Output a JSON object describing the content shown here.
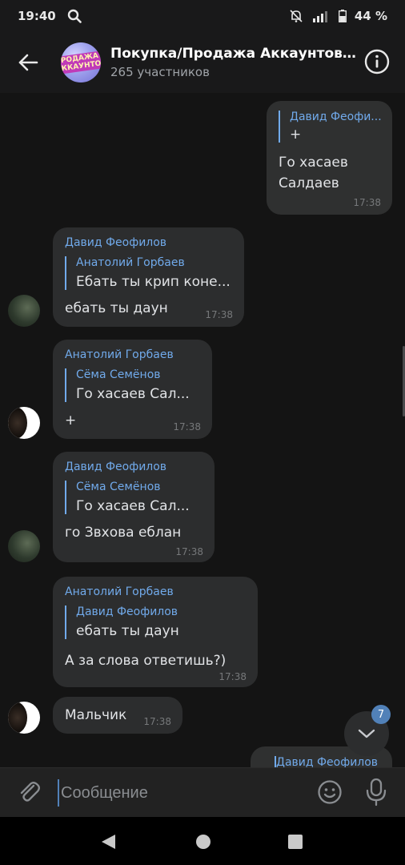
{
  "status_bar": {
    "time": "19:40",
    "battery": "44 %",
    "icons": [
      "search-icon",
      "mute-icon",
      "signal-icon",
      "battery-icon"
    ]
  },
  "header": {
    "title": "Покупка/Продажа Аккаунтов К.",
    "subtitle": "265 участников",
    "avatar_text": "ПРОДАЖА АККАУНТОВ"
  },
  "messages": [
    {
      "id": "m1",
      "direction": "out",
      "reply_name": "Давид Феофи...",
      "reply_text": "+",
      "body_lines": [
        "Го хасаев",
        "Салдаев"
      ],
      "time": "17:38"
    },
    {
      "id": "m2",
      "direction": "in",
      "sender": "Давид Феофилов",
      "reply_name": "Анатолий Горбаев",
      "reply_text": "Ебать ты крип коне...",
      "body": "ебать ты даун",
      "time": "17:38"
    },
    {
      "id": "m3",
      "direction": "in",
      "sender": "Анатолий Горбаев",
      "reply_name": "Сёма Семёнов",
      "reply_text": "Го хасаев  Сал...",
      "body": "+",
      "time": "17:38"
    },
    {
      "id": "m4",
      "direction": "in",
      "sender": "Давид Феофилов",
      "reply_name": "Сёма Семёнов",
      "reply_text": "Го хасаев  Сал...",
      "body": "го Звхова еблан",
      "time": "17:38"
    },
    {
      "id": "m5",
      "direction": "in",
      "sender": "Анатолий Горбаев",
      "reply_name": "Давид Феофилов",
      "reply_text": "ебать ты даун",
      "body": "А за слова ответишь?)",
      "time": "17:38"
    },
    {
      "id": "m6",
      "direction": "in",
      "body": "Мальчик",
      "time": "17:38"
    },
    {
      "id": "m7",
      "direction": "out",
      "reply_name": "Давид Феофилов"
    }
  ],
  "unread_badge": "7",
  "composer": {
    "placeholder": "Сообщение"
  },
  "colors": {
    "accent": "#71aaeb",
    "bubble": "#2c2d2e",
    "background": "#141414",
    "badge": "#5181b8"
  }
}
